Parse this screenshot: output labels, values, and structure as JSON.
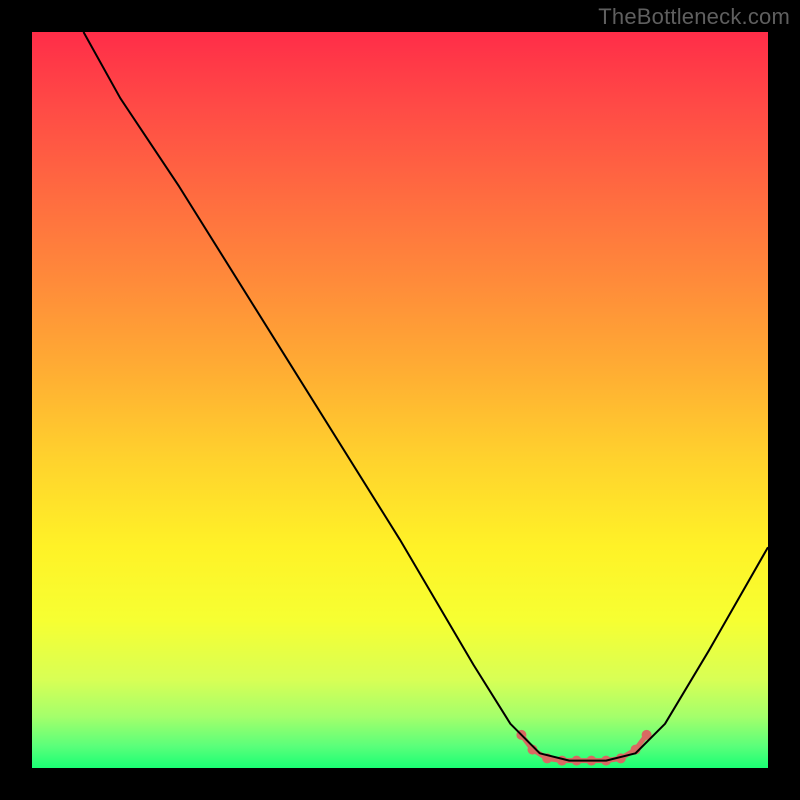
{
  "watermark": "TheBottleneck.com",
  "chart_data": {
    "type": "line",
    "title": "",
    "xlabel": "",
    "ylabel": "",
    "xlim": [
      0,
      100
    ],
    "ylim": [
      0,
      100
    ],
    "series": [
      {
        "name": "curve",
        "color": "#000000",
        "width": 2,
        "points": [
          {
            "x": 7,
            "y": 100
          },
          {
            "x": 12,
            "y": 91
          },
          {
            "x": 20,
            "y": 79
          },
          {
            "x": 35,
            "y": 55
          },
          {
            "x": 50,
            "y": 31
          },
          {
            "x": 60,
            "y": 14
          },
          {
            "x": 65,
            "y": 6
          },
          {
            "x": 69,
            "y": 2
          },
          {
            "x": 73,
            "y": 1
          },
          {
            "x": 78,
            "y": 1
          },
          {
            "x": 82,
            "y": 2
          },
          {
            "x": 86,
            "y": 6
          },
          {
            "x": 92,
            "y": 16
          },
          {
            "x": 100,
            "y": 30
          }
        ]
      },
      {
        "name": "bottom-dots",
        "color": "#d86a62",
        "marker_radius": 5,
        "stroke_width": 5,
        "points": [
          {
            "x": 66.5,
            "y": 4.5
          },
          {
            "x": 68.0,
            "y": 2.5
          },
          {
            "x": 70.0,
            "y": 1.3
          },
          {
            "x": 72.0,
            "y": 1.0
          },
          {
            "x": 74.0,
            "y": 1.0
          },
          {
            "x": 76.0,
            "y": 1.0
          },
          {
            "x": 78.0,
            "y": 1.0
          },
          {
            "x": 80.0,
            "y": 1.3
          },
          {
            "x": 82.0,
            "y": 2.5
          },
          {
            "x": 83.5,
            "y": 4.5
          }
        ]
      }
    ]
  }
}
